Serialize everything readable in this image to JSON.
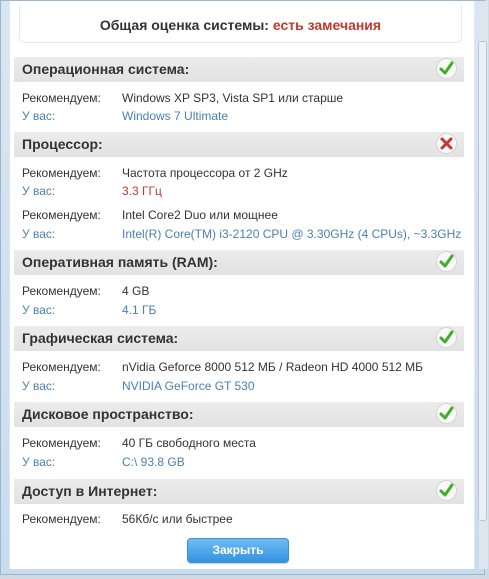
{
  "summary": {
    "label": "Общая оценка системы:",
    "status": "есть замечания"
  },
  "labels": {
    "recommended": "Рекомендуем:",
    "yours": "У вас:"
  },
  "sections": {
    "os": {
      "title": "Операционная система:",
      "status": "ok",
      "recommended": "Windows XP SP3, Vista SP1 или старше",
      "yours": "Windows 7 Ultimate"
    },
    "cpu": {
      "title": "Процессор:",
      "status": "fail",
      "recommended_freq": "Частота процессора от 2 GHz",
      "yours_freq": "3.3 ГГц",
      "recommended_model": "Intel Core2 Duo или мощнее",
      "yours_model": "Intel(R) Core(TM) i3-2120 CPU @ 3.30GHz (4 CPUs), ~3.3GHz"
    },
    "ram": {
      "title": "Оперативная память (RAM):",
      "status": "ok",
      "recommended": "4 GB",
      "yours": "4.1 ГБ"
    },
    "gpu": {
      "title": "Графическая система:",
      "status": "ok",
      "recommended": "nVidia Geforce 8000 512 МБ / Radeon HD 4000 512 МБ",
      "yours": "NVIDIA GeForce GT 530"
    },
    "disk": {
      "title": "Дисковое пространство:",
      "status": "ok",
      "recommended": "40 ГБ свободного места",
      "yours": "C:\\  93.8 GB"
    },
    "internet": {
      "title": "Доступ в Интернет:",
      "status": "ok",
      "recommended": "56Кб/с или быстрее"
    }
  },
  "buttons": {
    "close": "Закрыть"
  },
  "colors": {
    "ok": "#3fae2a",
    "fail": "#d0312d",
    "link": "#4c7fb0",
    "accent": "#3393e1"
  }
}
